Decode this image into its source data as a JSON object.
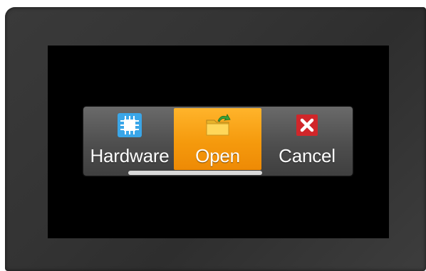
{
  "menu": {
    "items": [
      {
        "label": "Hardware",
        "icon": "chip-icon",
        "selected": false
      },
      {
        "label": "Open",
        "icon": "folder-open-icon",
        "selected": true
      },
      {
        "label": "Cancel",
        "icon": "close-icon",
        "selected": false
      }
    ]
  },
  "colors": {
    "highlight": "#f59a0d",
    "chip": "#3aa6e8",
    "cancel": "#d0262a",
    "bezel": "#333333",
    "screen": "#000000"
  }
}
